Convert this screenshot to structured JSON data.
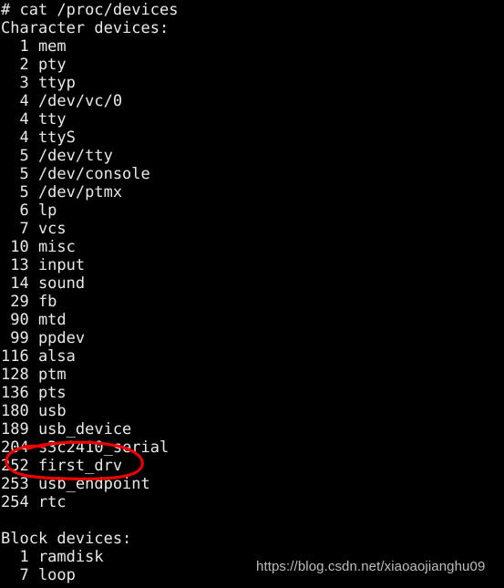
{
  "terminal": {
    "background_color": "#000000",
    "text_color": "#e8e8e8",
    "prompt_line": "# cat /proc/devices",
    "lines": [
      "# cat /proc/devices",
      "Character devices:",
      "  1 mem",
      "  2 pty",
      "  3 ttyp",
      "  4 /dev/vc/0",
      "  4 tty",
      "  4 ttyS",
      "  5 /dev/tty",
      "  5 /dev/console",
      "  5 /dev/ptmx",
      "  6 lp",
      "  7 vcs",
      " 10 misc",
      " 13 input",
      " 14 sound",
      " 29 fb",
      " 90 mtd",
      " 99 ppdev",
      "116 alsa",
      "128 ptm",
      "136 pts",
      "180 usb",
      "189 usb_device",
      "204 s3c2410_serial",
      "252 first_drv",
      "253 usb_endpoint",
      "254 rtc",
      "",
      "Block devices:",
      "  1 ramdisk",
      "  7 loop"
    ],
    "sections": [
      {
        "heading": "Character devices:",
        "entries": [
          {
            "major": "1",
            "name": "mem"
          },
          {
            "major": "2",
            "name": "pty"
          },
          {
            "major": "3",
            "name": "ttyp"
          },
          {
            "major": "4",
            "name": "/dev/vc/0"
          },
          {
            "major": "4",
            "name": "tty"
          },
          {
            "major": "4",
            "name": "ttyS"
          },
          {
            "major": "5",
            "name": "/dev/tty"
          },
          {
            "major": "5",
            "name": "/dev/console"
          },
          {
            "major": "5",
            "name": "/dev/ptmx"
          },
          {
            "major": "6",
            "name": "lp"
          },
          {
            "major": "7",
            "name": "vcs"
          },
          {
            "major": "10",
            "name": "misc"
          },
          {
            "major": "13",
            "name": "input"
          },
          {
            "major": "14",
            "name": "sound"
          },
          {
            "major": "29",
            "name": "fb"
          },
          {
            "major": "90",
            "name": "mtd"
          },
          {
            "major": "99",
            "name": "ppdev"
          },
          {
            "major": "116",
            "name": "alsa"
          },
          {
            "major": "128",
            "name": "ptm"
          },
          {
            "major": "136",
            "name": "pts"
          },
          {
            "major": "180",
            "name": "usb"
          },
          {
            "major": "189",
            "name": "usb_device"
          },
          {
            "major": "204",
            "name": "s3c2410_serial"
          },
          {
            "major": "252",
            "name": "first_drv"
          },
          {
            "major": "253",
            "name": "usb_endpoint"
          },
          {
            "major": "254",
            "name": "rtc"
          }
        ]
      },
      {
        "heading": "Block devices:",
        "entries": [
          {
            "major": "1",
            "name": "ramdisk"
          },
          {
            "major": "7",
            "name": "loop"
          }
        ]
      }
    ]
  },
  "annotation": {
    "type": "hand-drawn-ellipse",
    "color": "#ee0000",
    "stroke_width": 3,
    "highlighted_text": "252 first_drv",
    "target_line_index": 25
  },
  "watermark": {
    "text": "https://blog.csdn.net/xiaoaojianghu09",
    "color": "#bdbdbd"
  }
}
